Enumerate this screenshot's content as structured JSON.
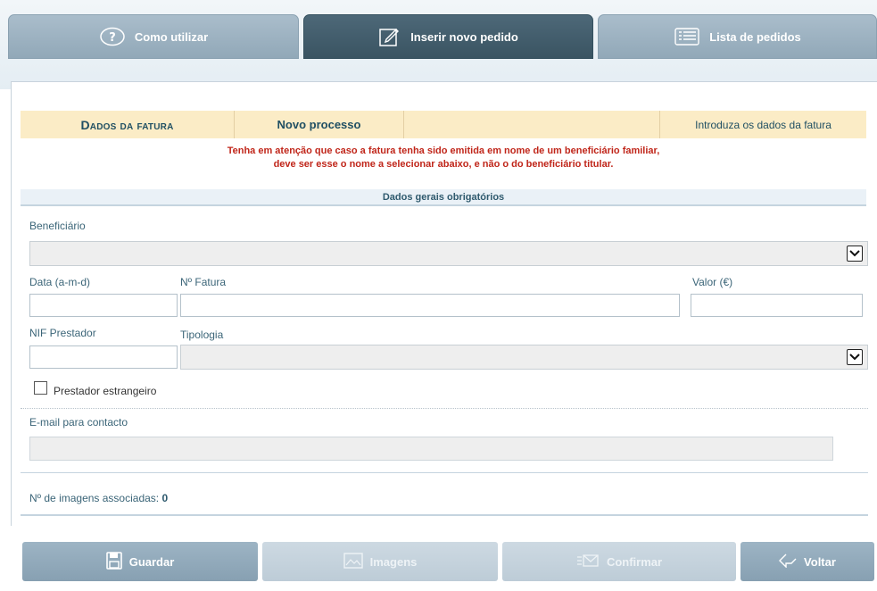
{
  "tabs": [
    {
      "label": "Como utilizar",
      "icon": "help-icon"
    },
    {
      "label": "Inserir novo pedido",
      "icon": "edit-icon"
    },
    {
      "label": "Lista de pedidos",
      "icon": "list-icon"
    }
  ],
  "header": {
    "title": "Dados da fatura",
    "process": "Novo processo",
    "intro": "Introduza os dados da fatura"
  },
  "warning": {
    "line1": "Tenha em atenção que caso a fatura tenha sido emitida em nome de um beneficiário familiar,",
    "line2": "deve ser esse o nome a selecionar abaixo, e não o do beneficiário titular."
  },
  "section_title": "Dados gerais obrigatórios",
  "form": {
    "beneficiario_label": "Beneficiário",
    "beneficiario_value": "",
    "data_label": "Data (a-m-d)",
    "data_value": "",
    "fatura_label": "Nº Fatura",
    "fatura_value": "",
    "valor_label": "Valor (€)",
    "valor_value": "",
    "nif_label": "NIF Prestador",
    "nif_value": "",
    "tipologia_label": "Tipologia",
    "tipologia_value": "",
    "estrangeiro_label": "Prestador estrangeiro",
    "estrangeiro_checked": false,
    "email_label": "E-mail para contacto",
    "email_value": ""
  },
  "images": {
    "label": "Nº de imagens associadas:",
    "count": "0"
  },
  "buttons": {
    "guardar": "Guardar",
    "imagens": "Imagens",
    "confirmar": "Confirmar",
    "voltar": "Voltar"
  },
  "colors": {
    "tab_active": "#3f5a68",
    "tab_inactive": "#9fb4c3",
    "header_bg": "#fbecc6",
    "warning": "#c0261a",
    "button_primary": "#8fa8b9",
    "button_disabled": "#c7d4de"
  }
}
